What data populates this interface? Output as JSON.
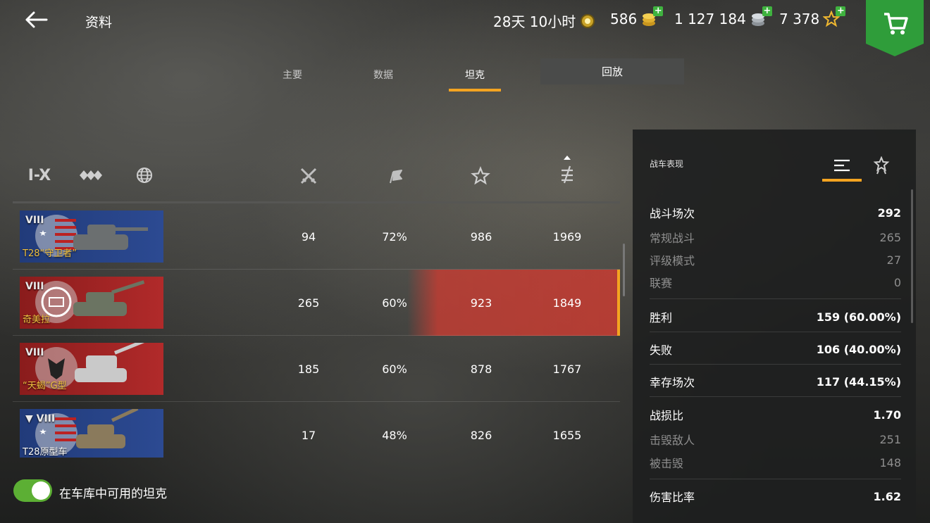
{
  "header": {
    "title": "资料",
    "premium_time": "28天 10小时",
    "gold": "586",
    "credits": "1 127 184",
    "free_xp": "7 378"
  },
  "tabs": [
    {
      "label": "主要"
    },
    {
      "label": "数据"
    },
    {
      "label": "坦克"
    },
    {
      "label": "回放"
    }
  ],
  "filters": {
    "tier_label": "I-X"
  },
  "tanks": [
    {
      "tier": "VIII",
      "name": "T28“守卫者”",
      "nation": "usa",
      "battles": "94",
      "winrate": "72%",
      "avg_xp": "986",
      "avg_dmg": "1969",
      "premium": true
    },
    {
      "tier": "VIII",
      "name": "奇美拉",
      "nation": "uk",
      "battles": "265",
      "winrate": "60%",
      "avg_xp": "923",
      "avg_dmg": "1849",
      "premium": true
    },
    {
      "tier": "VIII",
      "name": "“天蝎”G型",
      "nation": "germany",
      "battles": "185",
      "winrate": "60%",
      "avg_xp": "878",
      "avg_dmg": "1767",
      "premium": true
    },
    {
      "tier": "VIII",
      "name": "T28原型车",
      "nation": "usa",
      "battles": "17",
      "winrate": "48%",
      "avg_xp": "826",
      "avg_dmg": "1655",
      "premium": false
    }
  ],
  "toggle": {
    "label": "在车库中可用的坦克",
    "on": true
  },
  "panel": {
    "title": "战车表现",
    "stats": [
      {
        "label": "战斗场次",
        "value": "292"
      },
      {
        "label": "常规战斗",
        "value": "265"
      },
      {
        "label": "评级模式",
        "value": "27"
      },
      {
        "label": "联赛",
        "value": "0"
      },
      {
        "label": "胜利",
        "value": "159 (60.00%)"
      },
      {
        "label": "失败",
        "value": "106 (40.00%)"
      },
      {
        "label": "幸存场次",
        "value": "117 (44.15%)"
      },
      {
        "label": "战损比",
        "value": "1.70"
      },
      {
        "label": "击毁敌人",
        "value": "251"
      },
      {
        "label": "被击毁",
        "value": "148"
      },
      {
        "label": "伤害比率",
        "value": "1.62"
      }
    ]
  },
  "colors": {
    "accent": "#f4a421",
    "toggle_on": "#5caf34",
    "cart": "#2f9d3a",
    "selected_row": "#c83c32"
  }
}
